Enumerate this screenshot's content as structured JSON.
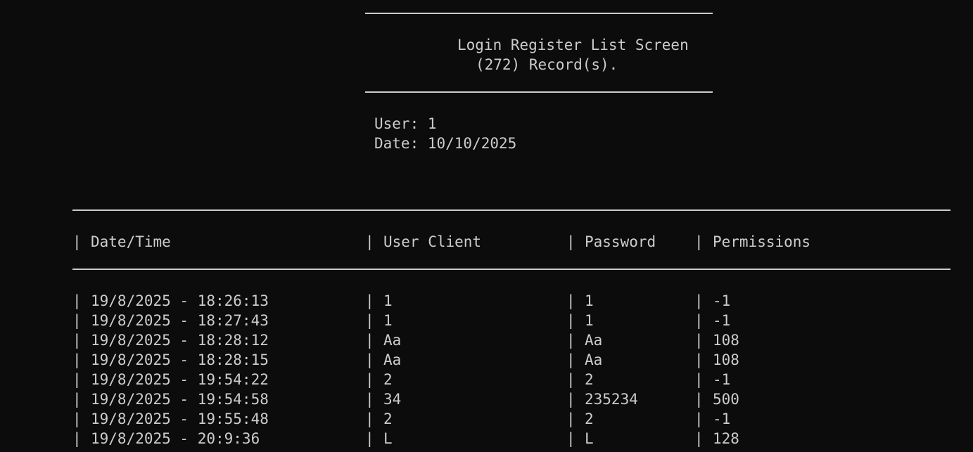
{
  "screen": {
    "title": "Login Register List Screen",
    "record_count": "(272) Record(s)."
  },
  "session": {
    "user": "User: 1",
    "date": "Date: 10/10/2025"
  },
  "table": {
    "separator": "|",
    "headers": {
      "datetime": "Date/Time",
      "user_client": "User Client",
      "password": "Password",
      "permissions": "Permissions"
    },
    "rows": [
      {
        "datetime": "19/8/2025 - 18:26:13",
        "user_client": "1",
        "password": "1",
        "permissions": "-1"
      },
      {
        "datetime": "19/8/2025 - 18:27:43",
        "user_client": "1",
        "password": "1",
        "permissions": "-1"
      },
      {
        "datetime": "19/8/2025 - 18:28:12",
        "user_client": "Aa",
        "password": "Aa",
        "permissions": "108"
      },
      {
        "datetime": "19/8/2025 - 18:28:15",
        "user_client": "Aa",
        "password": "Aa",
        "permissions": "108"
      },
      {
        "datetime": "19/8/2025 - 19:54:22",
        "user_client": "2",
        "password": "2",
        "permissions": "-1"
      },
      {
        "datetime": "19/8/2025 - 19:54:58",
        "user_client": "34",
        "password": "235234",
        "permissions": "500"
      },
      {
        "datetime": "19/8/2025 - 19:55:48",
        "user_client": "2",
        "password": "2",
        "permissions": "-1"
      },
      {
        "datetime": "19/8/2025 - 20:9:36",
        "user_client": "L",
        "password": "L",
        "permissions": "128"
      }
    ]
  }
}
